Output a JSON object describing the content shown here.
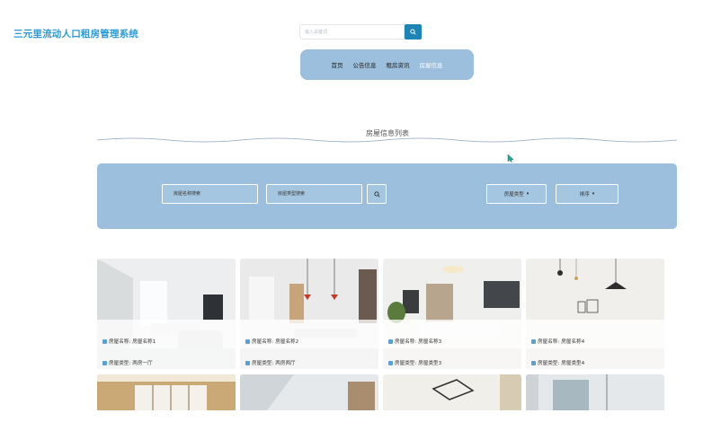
{
  "app": {
    "title": "三元里流动人口租房管理系统"
  },
  "search": {
    "placeholder": "输入关键词"
  },
  "nav": {
    "items": [
      {
        "label": "首页",
        "active": false
      },
      {
        "label": "公告信息",
        "active": false
      },
      {
        "label": "租房资讯",
        "active": false
      },
      {
        "label": "房屋信息",
        "active": true
      }
    ]
  },
  "section": {
    "title": "房屋信息列表"
  },
  "filter": {
    "name_placeholder": "房屋名称搜索",
    "type_placeholder": "房屋类型搜索",
    "type_dropdown": "房屋类型",
    "sort_dropdown": "排序"
  },
  "houses": [
    {
      "name_label": "房屋名称:",
      "name": "房屋名称1",
      "type_label": "房屋类型:",
      "type": "两房一厅"
    },
    {
      "name_label": "房屋名称:",
      "name": "房屋名称2",
      "type_label": "房屋类型:",
      "type": "两房两厅"
    },
    {
      "name_label": "房屋名称:",
      "name": "房屋名称3",
      "type_label": "房屋类型:",
      "type": "房屋类型3"
    },
    {
      "name_label": "房屋名称:",
      "name": "房屋名称4",
      "type_label": "房屋类型:",
      "type": "房屋类型4"
    }
  ],
  "colors": {
    "primary": "#2d9ad6",
    "panel": "#9bbfdc",
    "button": "#1e83b5"
  }
}
